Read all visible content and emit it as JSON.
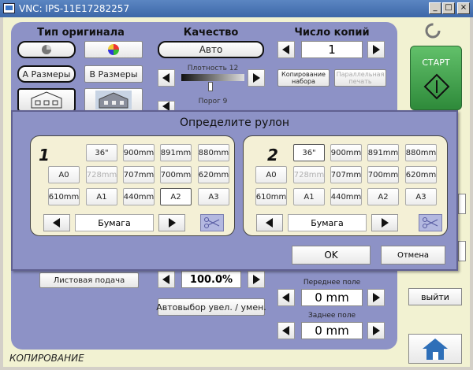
{
  "window": {
    "title": "VNC: IPS-11E17282257"
  },
  "original": {
    "header": "Тип оригинала",
    "size_a": "А Размеры",
    "size_b": "B Размеры",
    "sheet_feed": "Листовая подача"
  },
  "quality": {
    "header": "Качество",
    "mode": "Авто",
    "density_label": "Плотность 12",
    "threshold_label": "Порог 9"
  },
  "copies": {
    "header": "Число копий",
    "value": "1",
    "collate_label": "Копирование набора",
    "parallel_label": "Параллельная печать"
  },
  "zoom": {
    "value": "100.0%",
    "auto_label": "Автовыбор увел. / умен."
  },
  "margins": {
    "front_label": "Переднее поле",
    "front_value": "0 mm",
    "back_label": "Заднее поле",
    "back_value": "0 mm"
  },
  "right": {
    "start_label": "СТАРТ",
    "exit_label": "выйти"
  },
  "status": {
    "text": "КОПИРОВАНИЕ"
  },
  "dialog": {
    "title": "Определите рулон",
    "ok_label": "OK",
    "cancel_label": "Отмена",
    "groups": [
      {
        "number": "1",
        "buttons": [
          "36\"",
          "900mm",
          "891mm",
          "880mm",
          "A0",
          "728mm",
          "707mm",
          "700mm",
          "620mm",
          "610mm",
          "A1",
          "440mm",
          "A2",
          "A3"
        ],
        "disabled": [
          5
        ],
        "pressed": [
          12
        ],
        "paper_label": "Бумага"
      },
      {
        "number": "2",
        "buttons": [
          "36\"",
          "900mm",
          "891mm",
          "880mm",
          "A0",
          "728mm",
          "707mm",
          "700mm",
          "620mm",
          "610mm",
          "A1",
          "440mm",
          "A2",
          "A3"
        ],
        "disabled": [
          5
        ],
        "pressed": [
          0
        ],
        "paper_label": "Бумага"
      }
    ]
  },
  "colors": {
    "panel": "#8d92c6",
    "window_bg": "#f2f2d2",
    "start_green": "#3fa64b",
    "title_bar": "#3d67a8",
    "home_blue": "#2e6fb8"
  }
}
